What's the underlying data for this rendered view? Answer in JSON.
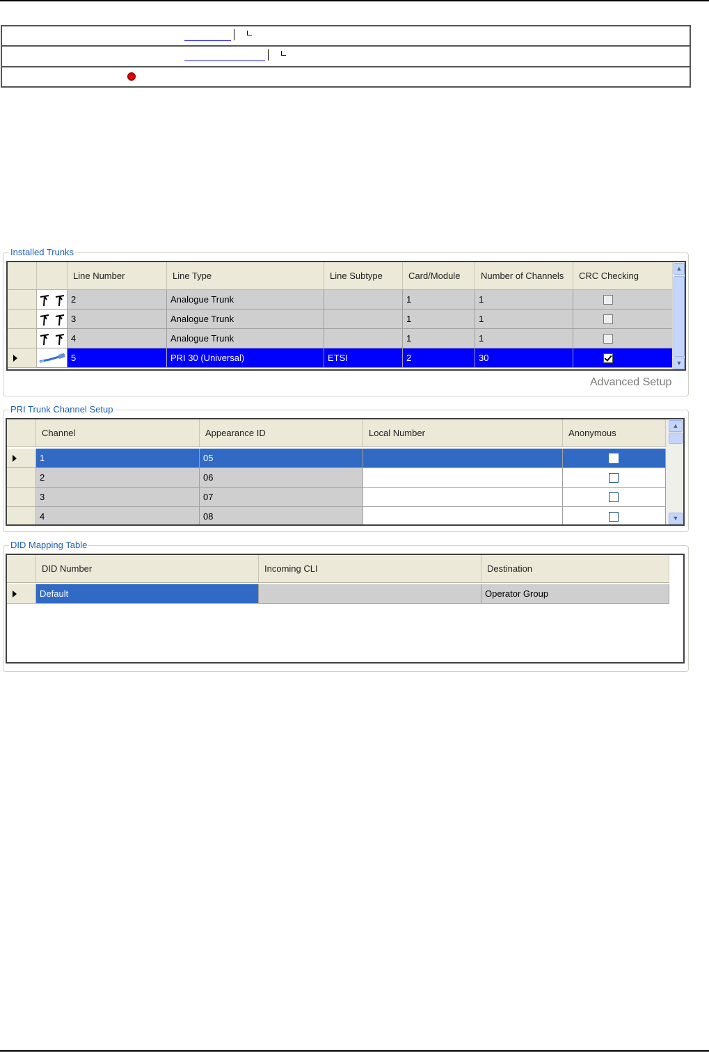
{
  "installed_trunks": {
    "title": "Installed Trunks",
    "columns": [
      "Line Number",
      "Line Type",
      "Line Subtype",
      "Card/Module",
      "Number of Channels",
      "CRC Checking"
    ],
    "rows": [
      {
        "line_number": "2",
        "line_type": "Analogue Trunk",
        "line_subtype": "",
        "card": "1",
        "channels": "1",
        "crc": false,
        "icon": "analogue-trunk-icon"
      },
      {
        "line_number": "3",
        "line_type": "Analogue Trunk",
        "line_subtype": "",
        "card": "1",
        "channels": "1",
        "crc": false,
        "icon": "analogue-trunk-icon"
      },
      {
        "line_number": "4",
        "line_type": "Analogue Trunk",
        "line_subtype": "",
        "card": "1",
        "channels": "1",
        "crc": false,
        "icon": "analogue-trunk-icon"
      },
      {
        "line_number": "5",
        "line_type": "PRI 30 (Universal)",
        "line_subtype": "ETSI",
        "card": "2",
        "channels": "30",
        "crc": true,
        "icon": "pri-cable-icon"
      }
    ],
    "advanced_setup": "Advanced Setup"
  },
  "pri_setup": {
    "title": "PRI Trunk Channel Setup",
    "columns": [
      "Channel",
      "Appearance ID",
      "Local Number",
      "Anonymous"
    ],
    "rows": [
      {
        "channel": "1",
        "appearance_id": "05",
        "local_number": "",
        "anonymous": false
      },
      {
        "channel": "2",
        "appearance_id": "06",
        "local_number": "",
        "anonymous": false
      },
      {
        "channel": "3",
        "appearance_id": "07",
        "local_number": "",
        "anonymous": false
      },
      {
        "channel": "4",
        "appearance_id": "08",
        "local_number": "",
        "anonymous": false
      }
    ]
  },
  "did_table": {
    "title": "DID Mapping Table",
    "columns": [
      "DID Number",
      "Incoming CLI",
      "Destination"
    ],
    "rows": [
      {
        "did_number": "Default",
        "incoming_cli": "",
        "destination": "Operator Group"
      }
    ]
  },
  "colors": {
    "selection_blue": "#0000ff",
    "selection_light": "#316ac5",
    "group_title": "#1a5fb4",
    "status_dot": "#e00000"
  }
}
